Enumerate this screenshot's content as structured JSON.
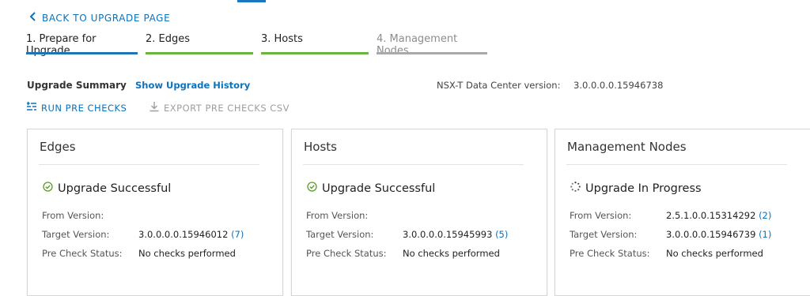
{
  "nav": {
    "back_label": "BACK TO UPGRADE PAGE"
  },
  "steps": [
    {
      "label": "1. Prepare for Upgrade"
    },
    {
      "label": "2. Edges"
    },
    {
      "label": "3. Hosts"
    },
    {
      "label": "4. Management Nodes"
    }
  ],
  "summary": {
    "title": "Upgrade Summary",
    "history_link": "Show Upgrade History",
    "version_label": "NSX-T Data Center version:",
    "version_value": "3.0.0.0.0.15946738"
  },
  "actions": {
    "run_label": "RUN PRE CHECKS",
    "export_label": "EXPORT PRE CHECKS CSV"
  },
  "labels": {
    "from": "From Version:",
    "target": "Target Version:",
    "precheck": "Pre Check Status:"
  },
  "cards": [
    {
      "title": "Edges",
      "status": "Upgrade Successful",
      "status_icon": "check-circle-icon",
      "from_version": "",
      "from_count": "",
      "target_version": "3.0.0.0.0.15946012",
      "target_count": "(7)",
      "precheck_status": "No checks performed"
    },
    {
      "title": "Hosts",
      "status": "Upgrade Successful",
      "status_icon": "check-circle-icon",
      "from_version": "",
      "from_count": "",
      "target_version": "3.0.0.0.0.15945993",
      "target_count": "(5)",
      "precheck_status": "No checks performed"
    },
    {
      "title": "Management Nodes",
      "status": "Upgrade In Progress",
      "status_icon": "spinner-icon",
      "from_version": "2.5.1.0.0.15314292",
      "from_count": "(2)",
      "target_version": "3.0.0.0.0.15946739",
      "target_count": "(1)",
      "precheck_status": "No checks performed"
    }
  ],
  "colors": {
    "link": "#0b72bb",
    "success": "#5aa220",
    "step_active": "#1d75b8",
    "step_done": "#6cb33f"
  }
}
